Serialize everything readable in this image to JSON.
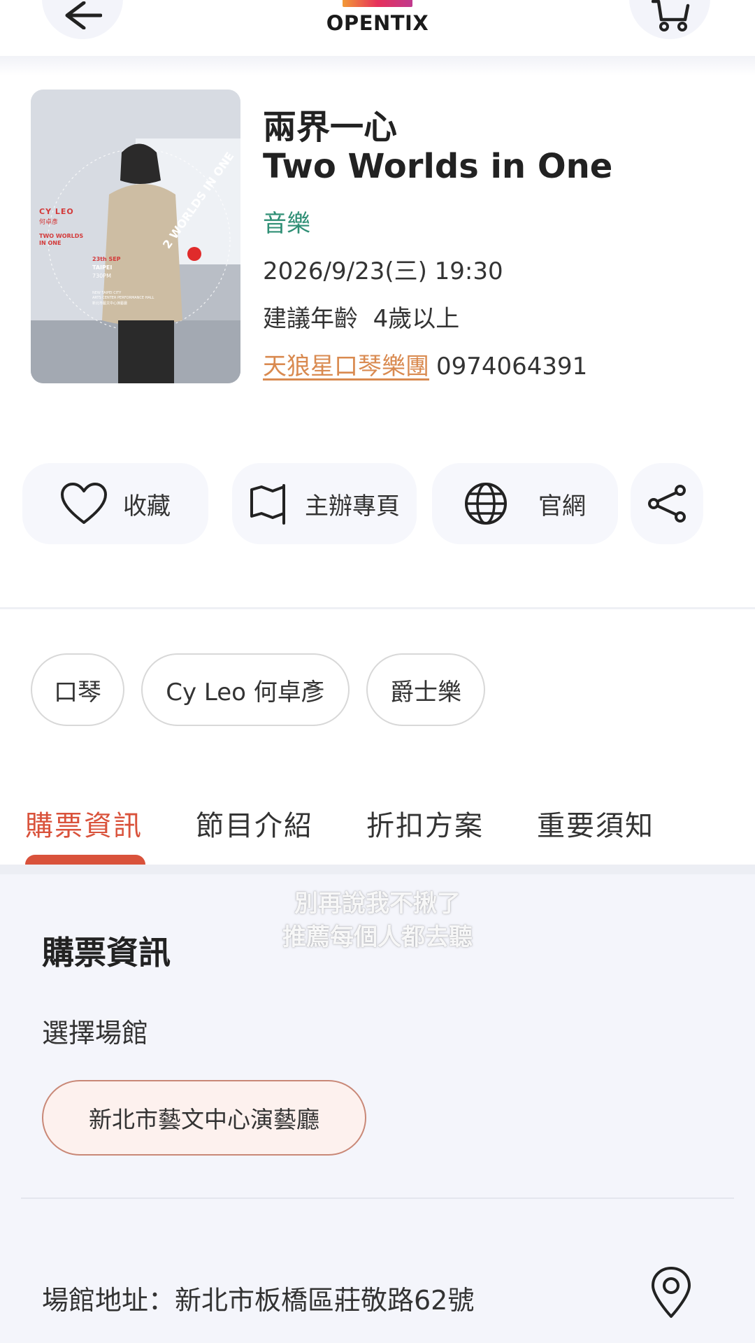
{
  "header": {
    "logo_text": "OPENTIX",
    "back_icon": "arrow-left-icon",
    "cart_icon": "cart-icon"
  },
  "event": {
    "title_zh": "兩界一心",
    "title_en": "Two Worlds in One",
    "category": "音樂",
    "datetime": "2026/9/23(三) 19:30",
    "age": "建議年齡  4歲以上",
    "organizer": "天狼星口琴樂團",
    "phone": "0974064391"
  },
  "poster": {
    "artist_en": "CY LEO",
    "artist_zh": "何卓彥",
    "line1": "TWO WORLDS",
    "line2": "IN ONE",
    "date": "23th SEP",
    "city": "TAIPEI",
    "time": "730PM",
    "venue_l1": "NEW TAIPEI CITY",
    "venue_l2": "ARTS CENTER PERFORMANCE HALL",
    "venue_l3": "新北市藝文中心演藝廳",
    "circle_text": "2 WORLDS IN ONE"
  },
  "actions": {
    "favorite": "收藏",
    "organizer_page": "主辦專頁",
    "website": "官網"
  },
  "tags": [
    "口琴",
    "Cy Leo 何卓彥",
    "爵士樂"
  ],
  "tabs": [
    "購票資訊",
    "節目介紹",
    "折扣方案",
    "重要須知"
  ],
  "overlay": {
    "line1": "別再說我不揪了",
    "line2": "推薦每個人都去聽"
  },
  "ticket_info": {
    "title": "購票資訊",
    "select_venue": "選擇場館",
    "venue": "新北市藝文中心演藝廳",
    "address": "場館地址：新北市板橋區莊敬路62號"
  },
  "colors": {
    "accent": "#d9523b",
    "category": "#2f8f75",
    "link": "#d98a50"
  }
}
